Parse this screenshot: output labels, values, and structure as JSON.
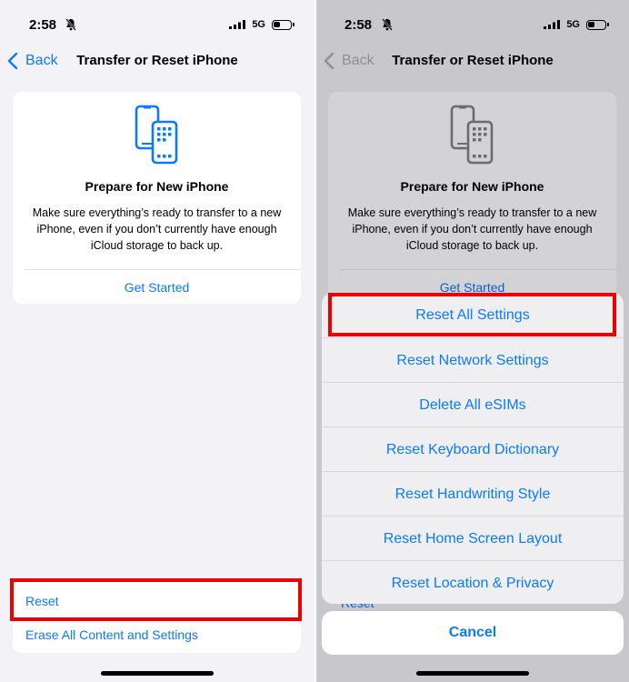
{
  "status_bar": {
    "time": "2:58",
    "network": "5G",
    "icons": [
      "bell-slash-icon",
      "signal-icon",
      "battery-icon"
    ]
  },
  "nav": {
    "back_label": "Back",
    "title": "Transfer or Reset iPhone"
  },
  "prepare_card": {
    "icon": "phones-transfer-icon",
    "title": "Prepare for New iPhone",
    "description": "Make sure everything’s ready to transfer to a new iPhone, even if you don’t currently have enough iCloud storage to back up.",
    "action_label": "Get Started"
  },
  "reset_list": {
    "items": [
      {
        "label": "Reset"
      },
      {
        "label": "Erase All Content and Settings"
      }
    ]
  },
  "action_sheet": {
    "options": [
      {
        "label": "Reset All Settings"
      },
      {
        "label": "Reset Network Settings"
      },
      {
        "label": "Delete All eSIMs"
      },
      {
        "label": "Reset Keyboard Dictionary"
      },
      {
        "label": "Reset Handwriting Style"
      },
      {
        "label": "Reset Home Screen Layout"
      },
      {
        "label": "Reset Location & Privacy"
      }
    ],
    "cancel_label": "Cancel"
  },
  "colors": {
    "accent": "#0a7aff",
    "highlight": "#ee0000",
    "background": "#f2f2f7",
    "dimmed_background": "#c8c7cc"
  }
}
